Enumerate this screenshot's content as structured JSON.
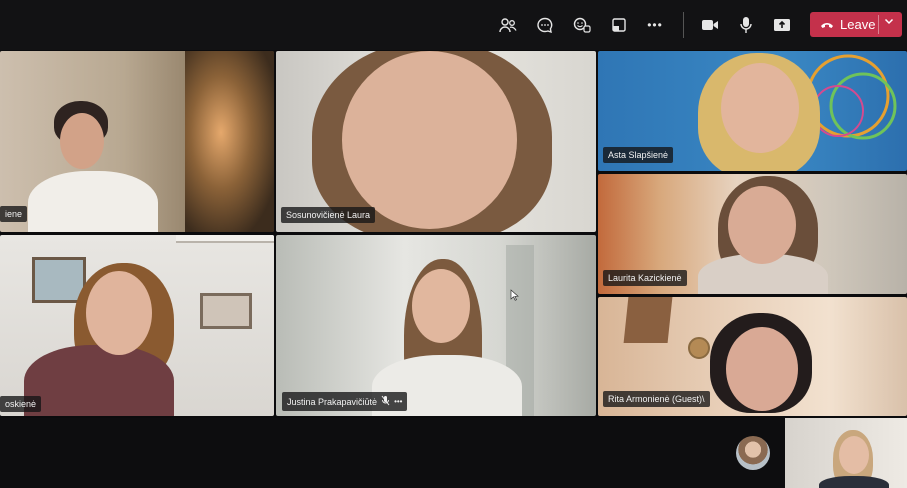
{
  "toolbar": {
    "icons": [
      "people-icon",
      "chat-icon",
      "react-icon",
      "share-tray-icon",
      "more-icon",
      "camera-icon",
      "mic-icon",
      "share-icon"
    ],
    "more_glyph": "•••",
    "leave_label": "Leave"
  },
  "participants": [
    {
      "name": "iene"
    },
    {
      "name": "Sosunovičienė Laura"
    },
    {
      "name": "Asta Slapšienė"
    },
    {
      "name": "Laurita Kazickienė"
    },
    {
      "name": "oskienė"
    },
    {
      "name": "Justina Prakapavičiūtė",
      "muted": true,
      "more_glyph": "•••"
    },
    {
      "name": "Rita Armonienė (Guest)\\"
    }
  ],
  "colors": {
    "leave": "#c4314b",
    "toolbar_bg": "#121214"
  }
}
